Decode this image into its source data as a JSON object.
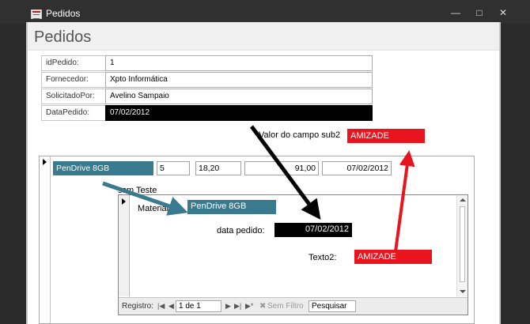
{
  "window": {
    "title": "Pedidos"
  },
  "form": {
    "title": "Pedidos",
    "fields": {
      "id_label": "idPedido:",
      "id_value": "1",
      "fornecedor_label": "Fornecedor:",
      "fornecedor_value": "Xpto Informática",
      "solicitado_label": "SolicitadoPor:",
      "solicitado_value": "Avelino Sampaio",
      "data_label": "DataPedido:",
      "data_value": "07/02/2012"
    },
    "sub2": {
      "label": "Valor do campo sub2",
      "value": "AMIZADE"
    }
  },
  "subform": {
    "row": {
      "material": "PenDrive 8GB",
      "quantidade": "5",
      "preco": "18,20",
      "total": "91,00",
      "data": "07/02/2012"
    },
    "caption": "ssm Teste",
    "inner": {
      "material_label": "Material:",
      "material_value": "PenDrive 8GB",
      "data_pedido_label": "data pedido:",
      "data_pedido_value": "07/02/2012",
      "texto2_label": "Texto2:",
      "texto2_value": "AMIZADE"
    },
    "navigation": {
      "record_label": "Registro:",
      "first_icon": "first-record-icon",
      "prev_icon": "prev-record-icon",
      "record_position": "1 de 1",
      "next_icon": "next-record-icon",
      "last_icon": "last-record-icon",
      "new_icon": "new-record-icon",
      "filter_label": "Sem Filtro",
      "search_label": "Pesquisar"
    }
  },
  "colors": {
    "highlight_red": "#e8141e",
    "teal": "#3a7a8e",
    "title_bar": "#303030",
    "arrow_black": "#000000",
    "arrow_teal": "#3a7a8e",
    "arrow_red": "#e8141e"
  }
}
